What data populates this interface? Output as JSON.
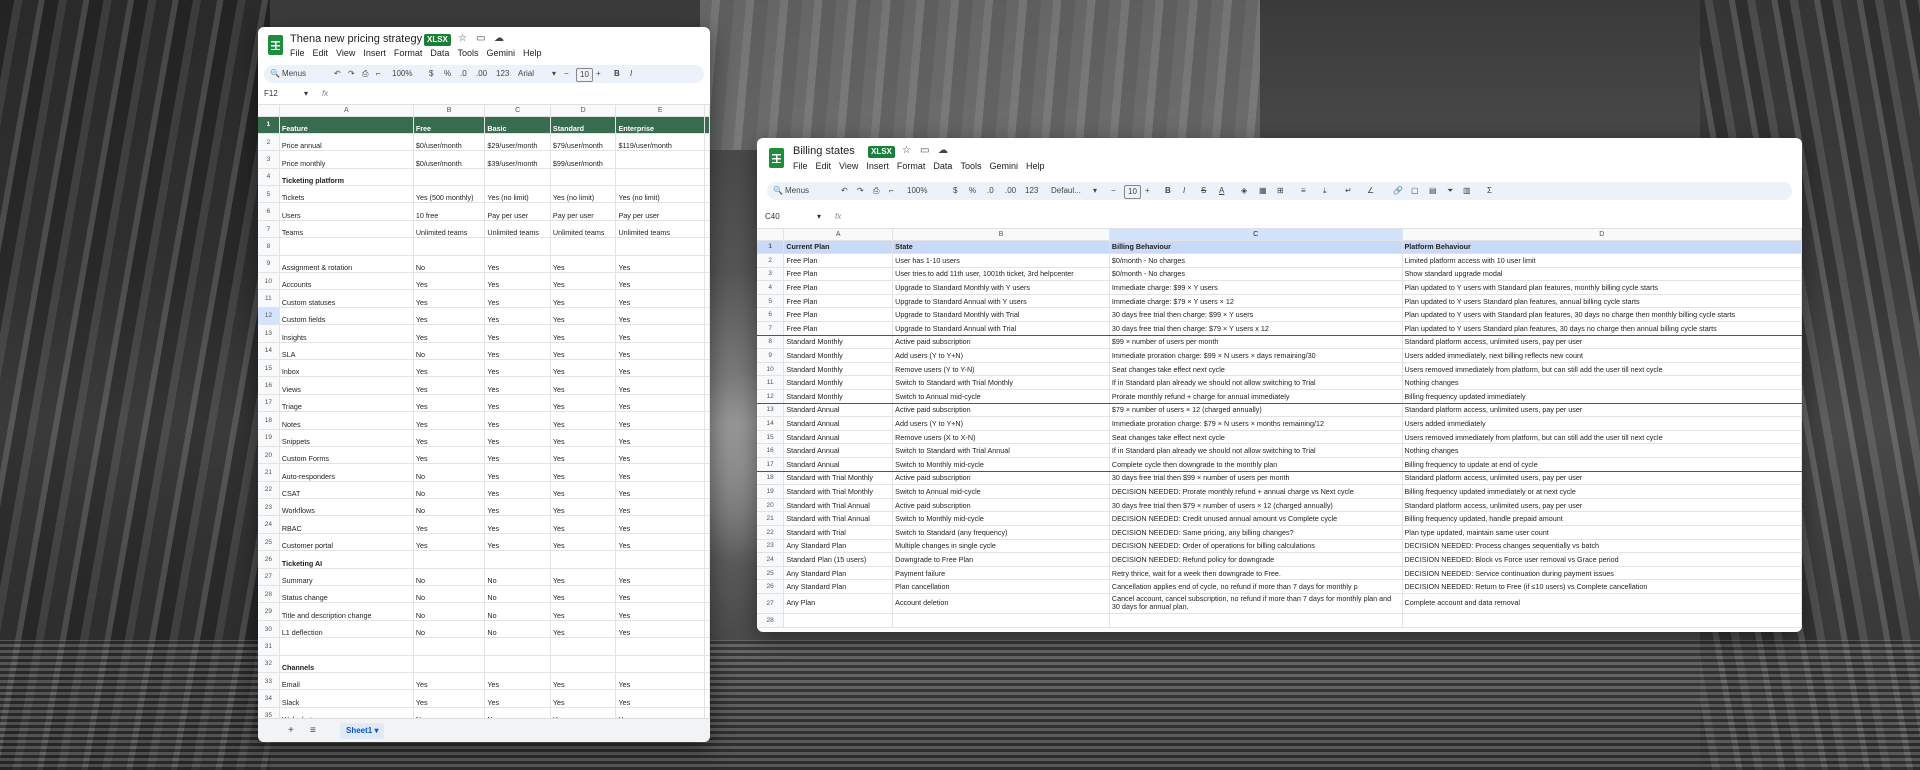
{
  "left_sheet": {
    "title": "Thena new pricing strategy",
    "badge": "XLSX",
    "menu": [
      "File",
      "Edit",
      "View",
      "Insert",
      "Format",
      "Data",
      "Tools",
      "Gemini",
      "Help"
    ],
    "toolbar": {
      "search": "Menus",
      "zoom": "100%",
      "currency": "$",
      "percent": "%",
      "dec_down": ".0",
      "dec_up": ".00",
      "number_format": "123",
      "font": "Arial",
      "font_size": "10",
      "minus": "−",
      "plus": "+",
      "bold": "B",
      "italic": "I"
    },
    "cell_ref": "F12",
    "fx": "fx",
    "columns": [
      "A",
      "B",
      "C",
      "D",
      "E"
    ],
    "rows": [
      {
        "n": "1",
        "cells": [
          "Feature",
          "Free",
          "Basic",
          "Standard",
          "Enterprise"
        ]
      },
      {
        "n": "2",
        "cells": [
          "Price annual",
          "$0/user/month",
          "$29/user/month",
          "$79/user/month",
          "$119/user/month"
        ]
      },
      {
        "n": "3",
        "cells": [
          "Price monthly",
          "$0/user/month",
          "$39/user/month",
          "$99/user/month",
          ""
        ]
      },
      {
        "n": "4",
        "cells": [
          "Ticketing platform",
          "",
          "",
          "",
          ""
        ]
      },
      {
        "n": "5",
        "cells": [
          "Tickets",
          "Yes (500 monthly)",
          "Yes (no limit)",
          "Yes (no limit)",
          "Yes (no limit)"
        ]
      },
      {
        "n": "6",
        "cells": [
          "Users",
          "10 free",
          "Pay per user",
          "Pay per user",
          "Pay per user"
        ]
      },
      {
        "n": "7",
        "cells": [
          "Teams",
          "Unlimited teams",
          "Unlimited teams",
          "Unlimited teams",
          "Unlimited teams"
        ]
      },
      {
        "n": "8",
        "cells": [
          "",
          "",
          "",
          "",
          ""
        ]
      },
      {
        "n": "9",
        "cells": [
          "Assignment & rotation",
          "No",
          "Yes",
          "Yes",
          "Yes"
        ]
      },
      {
        "n": "10",
        "cells": [
          "Accounts",
          "Yes",
          "Yes",
          "Yes",
          "Yes"
        ]
      },
      {
        "n": "11",
        "cells": [
          "Custom statuses",
          "Yes",
          "Yes",
          "Yes",
          "Yes"
        ]
      },
      {
        "n": "12",
        "cells": [
          "Custom fields",
          "Yes",
          "Yes",
          "Yes",
          "Yes"
        ]
      },
      {
        "n": "13",
        "cells": [
          "Insights",
          "Yes",
          "Yes",
          "Yes",
          "Yes"
        ]
      },
      {
        "n": "14",
        "cells": [
          "SLA",
          "No",
          "Yes",
          "Yes",
          "Yes"
        ]
      },
      {
        "n": "15",
        "cells": [
          "Inbox",
          "Yes",
          "Yes",
          "Yes",
          "Yes"
        ]
      },
      {
        "n": "16",
        "cells": [
          "Views",
          "Yes",
          "Yes",
          "Yes",
          "Yes"
        ]
      },
      {
        "n": "17",
        "cells": [
          "Triage",
          "Yes",
          "Yes",
          "Yes",
          "Yes"
        ]
      },
      {
        "n": "18",
        "cells": [
          "Notes",
          "Yes",
          "Yes",
          "Yes",
          "Yes"
        ]
      },
      {
        "n": "19",
        "cells": [
          "Snippets",
          "Yes",
          "Yes",
          "Yes",
          "Yes"
        ]
      },
      {
        "n": "20",
        "cells": [
          "Custom Forms",
          "Yes",
          "Yes",
          "Yes",
          "Yes"
        ]
      },
      {
        "n": "21",
        "cells": [
          "Auto-responders",
          "No",
          "Yes",
          "Yes",
          "Yes"
        ]
      },
      {
        "n": "22",
        "cells": [
          "CSAT",
          "No",
          "Yes",
          "Yes",
          "Yes"
        ]
      },
      {
        "n": "23",
        "cells": [
          "Workflows",
          "No",
          "Yes",
          "Yes",
          "Yes"
        ]
      },
      {
        "n": "24",
        "cells": [
          "RBAC",
          "Yes",
          "Yes",
          "Yes",
          "Yes"
        ]
      },
      {
        "n": "25",
        "cells": [
          "Customer portal",
          "Yes",
          "Yes",
          "Yes",
          "Yes"
        ]
      },
      {
        "n": "26",
        "cells": [
          "Ticketing AI",
          "",
          "",
          "",
          ""
        ]
      },
      {
        "n": "27",
        "cells": [
          "Summary",
          "No",
          "No",
          "Yes",
          "Yes"
        ]
      },
      {
        "n": "28",
        "cells": [
          "Status change",
          "No",
          "No",
          "Yes",
          "Yes"
        ]
      },
      {
        "n": "29",
        "cells": [
          "Title and description change",
          "No",
          "No",
          "Yes",
          "Yes"
        ]
      },
      {
        "n": "30",
        "cells": [
          "L1 deflection",
          "No",
          "No",
          "Yes",
          "Yes"
        ]
      },
      {
        "n": "31",
        "cells": [
          "",
          "",
          "",
          "",
          ""
        ]
      },
      {
        "n": "32",
        "cells": [
          "Channels",
          "",
          "",
          "",
          ""
        ]
      },
      {
        "n": "33",
        "cells": [
          "Email",
          "Yes",
          "Yes",
          "Yes",
          "Yes"
        ]
      },
      {
        "n": "34",
        "cells": [
          "Slack",
          "Yes",
          "Yes",
          "Yes",
          "Yes"
        ]
      },
      {
        "n": "35",
        "cells": [
          "Web chat",
          "No",
          "No",
          "Yes",
          "Yes"
        ]
      }
    ],
    "sheet_tab": "Sheet1",
    "add_sheet": "+",
    "all_sheets": "≡"
  },
  "right_sheet": {
    "title": "Billing states",
    "badge": "XLSX",
    "menu": [
      "File",
      "Edit",
      "View",
      "Insert",
      "Format",
      "Data",
      "Tools",
      "Gemini",
      "Help"
    ],
    "toolbar": {
      "search": "Menus",
      "zoom": "100%",
      "currency": "$",
      "percent": "%",
      "dec_down": ".0",
      "dec_up": ".00",
      "number_format": "123",
      "font": "Defaul...",
      "font_size": "10",
      "minus": "−",
      "plus": "+",
      "bold": "B",
      "italic": "I",
      "strike": "S",
      "text_color": "A",
      "sigma": "Σ"
    },
    "cell_ref": "C40",
    "fx": "fx",
    "columns": [
      "A",
      "B",
      "C",
      "D"
    ],
    "rows": [
      {
        "n": "1",
        "cells": [
          "Current Plan",
          "State",
          "Billing Behaviour",
          "Platform Behaviour"
        ]
      },
      {
        "n": "2",
        "cells": [
          "Free Plan",
          "User has 1-10 users",
          "$0/month - No charges",
          "Limited platform access with 10 user limit"
        ]
      },
      {
        "n": "3",
        "cells": [
          "Free Plan",
          "User tries to add 11th user, 1001th ticket, 3rd helpcenter",
          "$0/month - No charges",
          "Show standard upgrade modal"
        ]
      },
      {
        "n": "4",
        "cells": [
          "Free Plan",
          "Upgrade to Standard Monthly with Y users",
          "Immediate charge: $99 × Y users",
          "Plan updated to Y users with Standard plan features, monthly billing cycle starts"
        ]
      },
      {
        "n": "5",
        "cells": [
          "Free Plan",
          "Upgrade to Standard Annual with Y users",
          "Immediate charge: $79 × Y users × 12",
          "Plan updated to Y users Standard plan features, annual billing cycle starts"
        ]
      },
      {
        "n": "6",
        "cells": [
          "Free Plan",
          "Upgrade to Standard Monthly with Trial",
          "30 days free trial then charge: $99 × Y users",
          "Plan updated to Y users with Standard plan features, 30 days no charge then monthly billing cycle starts"
        ]
      },
      {
        "n": "7",
        "cells": [
          "Free Plan",
          "Upgrade to Standard Annual with Trial",
          "30 days free trial then charge: $79 × Y users x 12",
          "Plan updated to Y users Standard plan features, 30 days no charge then annual billing cycle starts"
        ]
      },
      {
        "n": "8",
        "cells": [
          "Standard Monthly",
          "Active paid subscription",
          "$99 × number of users per month",
          "Standard platform access, unlimited users, pay per user"
        ]
      },
      {
        "n": "9",
        "cells": [
          "Standard Monthly",
          "Add users (Y to Y+N)",
          "Immediate proration charge: $99 × N users × days remaining/30",
          "Users added immediately, next billing reflects new count"
        ]
      },
      {
        "n": "10",
        "cells": [
          "Standard Monthly",
          "Remove users (Y to Y-N)",
          "Seat changes take effect next cycle",
          "Users removed immediately from platform, but can still add the user till next cycle"
        ]
      },
      {
        "n": "11",
        "cells": [
          "Standard Monthly",
          "Switch to Standard with Trial Monthly",
          "If in Standard plan already we should not allow switching to Trial",
          "Nothing changes"
        ]
      },
      {
        "n": "12",
        "cells": [
          "Standard Monthly",
          "Switch to Annual mid-cycle",
          "Prorate monthly refund + charge for annual immediately",
          "Billing frequency updated immediately"
        ]
      },
      {
        "n": "13",
        "cells": [
          "Standard Annual",
          "Active paid subscription",
          "$79 × number of users × 12 (charged annually)",
          "Standard platform access, unlimited users, pay per user"
        ]
      },
      {
        "n": "14",
        "cells": [
          "Standard Annual",
          "Add users (Y to Y+N)",
          "Immediate proration charge: $79 × N users × months remaining/12",
          "Users added immediately"
        ]
      },
      {
        "n": "15",
        "cells": [
          "Standard Annual",
          "Remove users (X to X-N)",
          "Seat changes take effect next cycle",
          "Users removed immediately from platform, but can still add the user till next cycle"
        ]
      },
      {
        "n": "16",
        "cells": [
          "Standard Annual",
          "Switch to Standard with Trial Annual",
          "If in Standard plan already we should not allow switching to Trial",
          "Nothing changes"
        ]
      },
      {
        "n": "17",
        "cells": [
          "Standard Annual",
          "Switch to Monthly mid-cycle",
          "Complete cycle then downgrade to the monthly plan",
          "Billing frequency to update at end of cycle"
        ]
      },
      {
        "n": "18",
        "cells": [
          "Standard with Trial Monthly",
          "Active paid subscription",
          "30 days free trial then $99 × number of users per month",
          "Standard platform access, unlimited users, pay per user"
        ]
      },
      {
        "n": "19",
        "cells": [
          "Standard with Trial Monthly",
          "Switch to Annual mid-cycle",
          "DECISION NEEDED: Prorate monthly refund + annual charge vs Next cycle",
          "Billing frequency updated immediately or at next cycle"
        ]
      },
      {
        "n": "20",
        "cells": [
          "Standard with Trial Annual",
          "Active paid subscription",
          "30 days free trial then $79 × number of users × 12 (charged annually)",
          "Standard platform access, unlimited users, pay per user"
        ]
      },
      {
        "n": "21",
        "cells": [
          "Standard with Trial Annual",
          "Switch to Monthly mid-cycle",
          "DECISION NEEDED: Credit unused annual amount vs Complete cycle",
          "Billing frequency updated, handle prepaid amount"
        ]
      },
      {
        "n": "22",
        "cells": [
          "Standard with Trial",
          "Switch to Standard (any frequency)",
          "DECISION NEEDED: Same pricing, any billing changes?",
          "Plan type updated, maintain same user count"
        ]
      },
      {
        "n": "23",
        "cells": [
          "Any Standard Plan",
          "Multiple changes in single cycle",
          "DECISION NEEDED: Order of operations for billing calculations",
          "DECISION NEEDED: Process changes sequentially vs batch"
        ]
      },
      {
        "n": "24",
        "cells": [
          "Standard Plan (15 users)",
          "Downgrade to Free Plan",
          "DECISION NEEDED: Refund policy for downgrade",
          "DECISION NEEDED: Block vs Force user removal vs Grace period"
        ]
      },
      {
        "n": "25",
        "cells": [
          "Any Standard Plan",
          "Payment failure",
          "Retry thrice, wait for a week then downgrade to Free.",
          "DECISION NEEDED: Service continuation during payment issues"
        ]
      },
      {
        "n": "26",
        "cells": [
          "Any Standard Plan",
          "Plan cancellation",
          "Cancellation applies end of cycle, no refund if more than 7 days for monthly p",
          "DECISION NEEDED: Return to Free (if ≤10 users) vs Complete cancellation"
        ]
      },
      {
        "n": "27",
        "cells": [
          "Any Plan",
          "Account deletion",
          "Cancel account, cancel subscription, no refund if more than 7 days for monthly plan and 30 days for annual plan.",
          "Complete account and data removal"
        ]
      },
      {
        "n": "28",
        "cells": [
          "",
          "",
          "",
          ""
        ]
      }
    ]
  }
}
